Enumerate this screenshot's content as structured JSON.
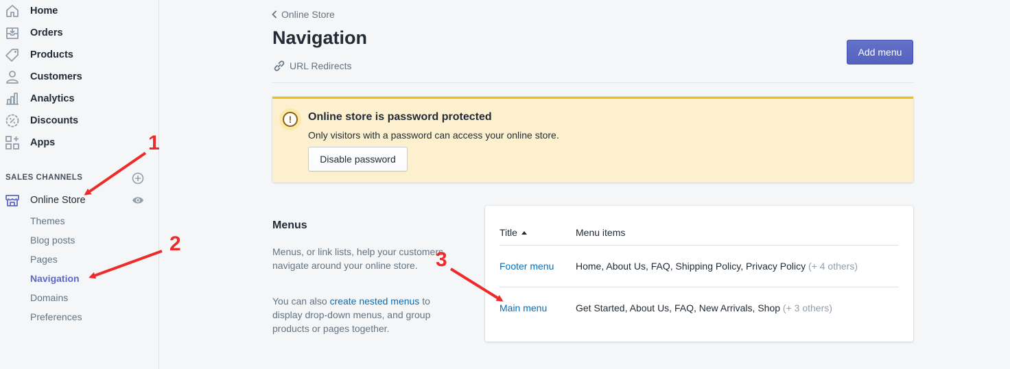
{
  "sidebar": {
    "items": [
      {
        "label": "Home",
        "icon": "home-icon"
      },
      {
        "label": "Orders",
        "icon": "orders-icon"
      },
      {
        "label": "Products",
        "icon": "tag-icon"
      },
      {
        "label": "Customers",
        "icon": "person-icon"
      },
      {
        "label": "Analytics",
        "icon": "bar-chart-icon"
      },
      {
        "label": "Discounts",
        "icon": "discount-icon"
      },
      {
        "label": "Apps",
        "icon": "apps-icon"
      }
    ],
    "sales_channels_heading": "SALES CHANNELS",
    "online_store": {
      "label": "Online Store",
      "icon": "store-icon"
    },
    "sub_items": [
      "Themes",
      "Blog posts",
      "Pages",
      "Navigation",
      "Domains",
      "Preferences"
    ],
    "active_sub_item": "Navigation"
  },
  "header": {
    "breadcrumb": "Online Store",
    "title": "Navigation",
    "url_redirects": "URL Redirects",
    "add_menu_label": "Add menu"
  },
  "banner": {
    "title": "Online store is password protected",
    "text": "Only visitors with a password can access your online store.",
    "button_label": "Disable password"
  },
  "menus_section": {
    "heading": "Menus",
    "description": "Menus, or link lists, help your customers navigate around your online store.",
    "desc2_before": "You can also ",
    "desc2_link": "create nested menus",
    "desc2_after": " to display drop-down menus, and group products or pages together."
  },
  "table": {
    "col_title": "Title",
    "col_items": "Menu items",
    "rows": [
      {
        "title": "Footer menu",
        "items": "Home, About Us, FAQ, Shipping Policy, Privacy Policy",
        "others": "(+ 4 others)"
      },
      {
        "title": "Main menu",
        "items": "Get Started, About Us, FAQ, New Arrivals, Shop",
        "others": "(+ 3 others)"
      }
    ]
  },
  "annotations": [
    "1",
    "2",
    "3"
  ],
  "colors": {
    "accent": "#5c6ac4",
    "link": "#006fbb",
    "banner_bg": "#fdf0cf",
    "banner_border": "#eec200",
    "annotation": "#ee2b2b"
  }
}
